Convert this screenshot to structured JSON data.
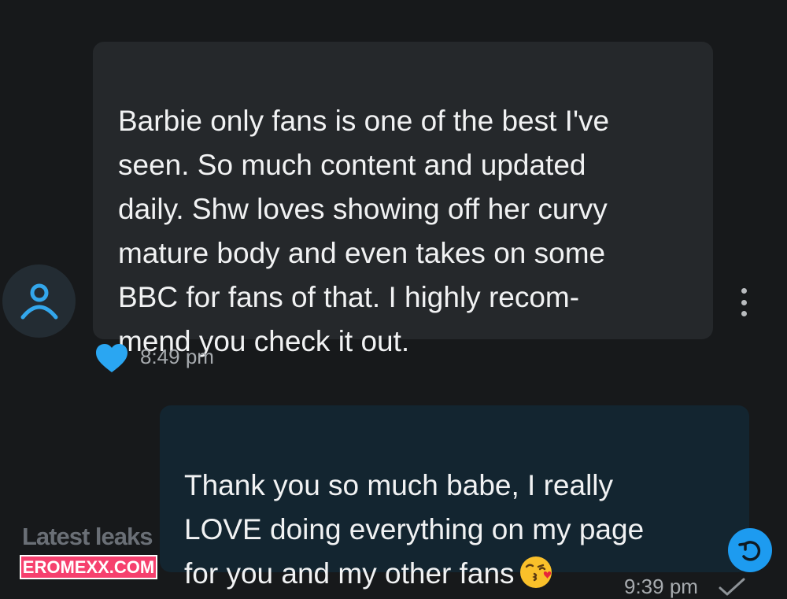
{
  "incoming": {
    "text": "Barbie only fans is one of the best I've\nseen. So much content and updated\ndaily. Shw loves showing off her curvy\nmature body and even takes on some\nBBC for fans of that. I highly recom-\nmend you check it out.",
    "time": "8:49 pm",
    "reaction": "heart-icon"
  },
  "outgoing": {
    "text": "Thank you so much babe, I really\nLOVE doing everything on my page\nfor you and my other fans",
    "emoji": "face-blowing-a-kiss",
    "time": "9:39 pm",
    "status": "sent-check-icon"
  },
  "watermark": {
    "line1": "Latest leaks",
    "line2": "EROMEXX.COM"
  },
  "colors": {
    "background": "#17191b",
    "incoming_bubble": "#25282b",
    "outgoing_bubble": "#132530",
    "accent": "#1d9bf0",
    "watermark_badge": "#f6406e"
  }
}
